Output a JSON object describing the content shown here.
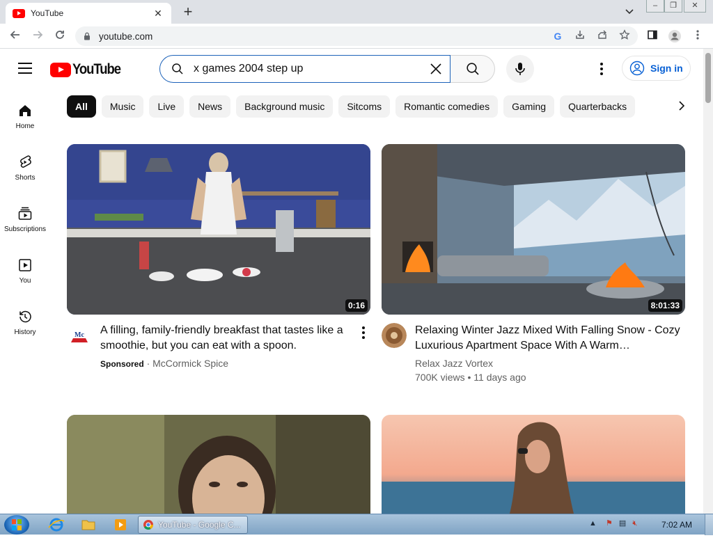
{
  "browser": {
    "tab_title": "YouTube",
    "url": "youtube.com",
    "new_tab_label": "+",
    "close_tab_label": "✕"
  },
  "youtube": {
    "logo_text": "YouTube",
    "search_value": "x games 2004 step up",
    "sign_in_label": "Sign in",
    "sidebar": [
      {
        "label": "Home",
        "icon": "home-icon"
      },
      {
        "label": "Shorts",
        "icon": "shorts-icon"
      },
      {
        "label": "Subscriptions",
        "icon": "subscriptions-icon"
      },
      {
        "label": "You",
        "icon": "you-icon"
      },
      {
        "label": "History",
        "icon": "history-icon"
      }
    ],
    "chips": [
      "All",
      "Music",
      "Live",
      "News",
      "Background music",
      "Sitcoms",
      "Romantic comedies",
      "Gaming",
      "Quarterbacks"
    ],
    "videos": [
      {
        "title": "A filling, family-friendly breakfast that tastes like a smoothie, but you can eat with a spoon.",
        "sponsored": "Sponsored",
        "channel": "McCormick Spice",
        "duration": "0:16",
        "avatar_text": "McCormick"
      },
      {
        "title": "Relaxing Winter Jazz Mixed With Falling Snow - Cozy Luxurious Apartment Space With A Warm…",
        "channel": "Relax Jazz Vortex",
        "stats": "700K views • 11 days ago",
        "duration": "8:01:33"
      }
    ]
  },
  "taskbar": {
    "chrome_label": "YouTube - Google C...",
    "clock": "7:02 AM"
  }
}
